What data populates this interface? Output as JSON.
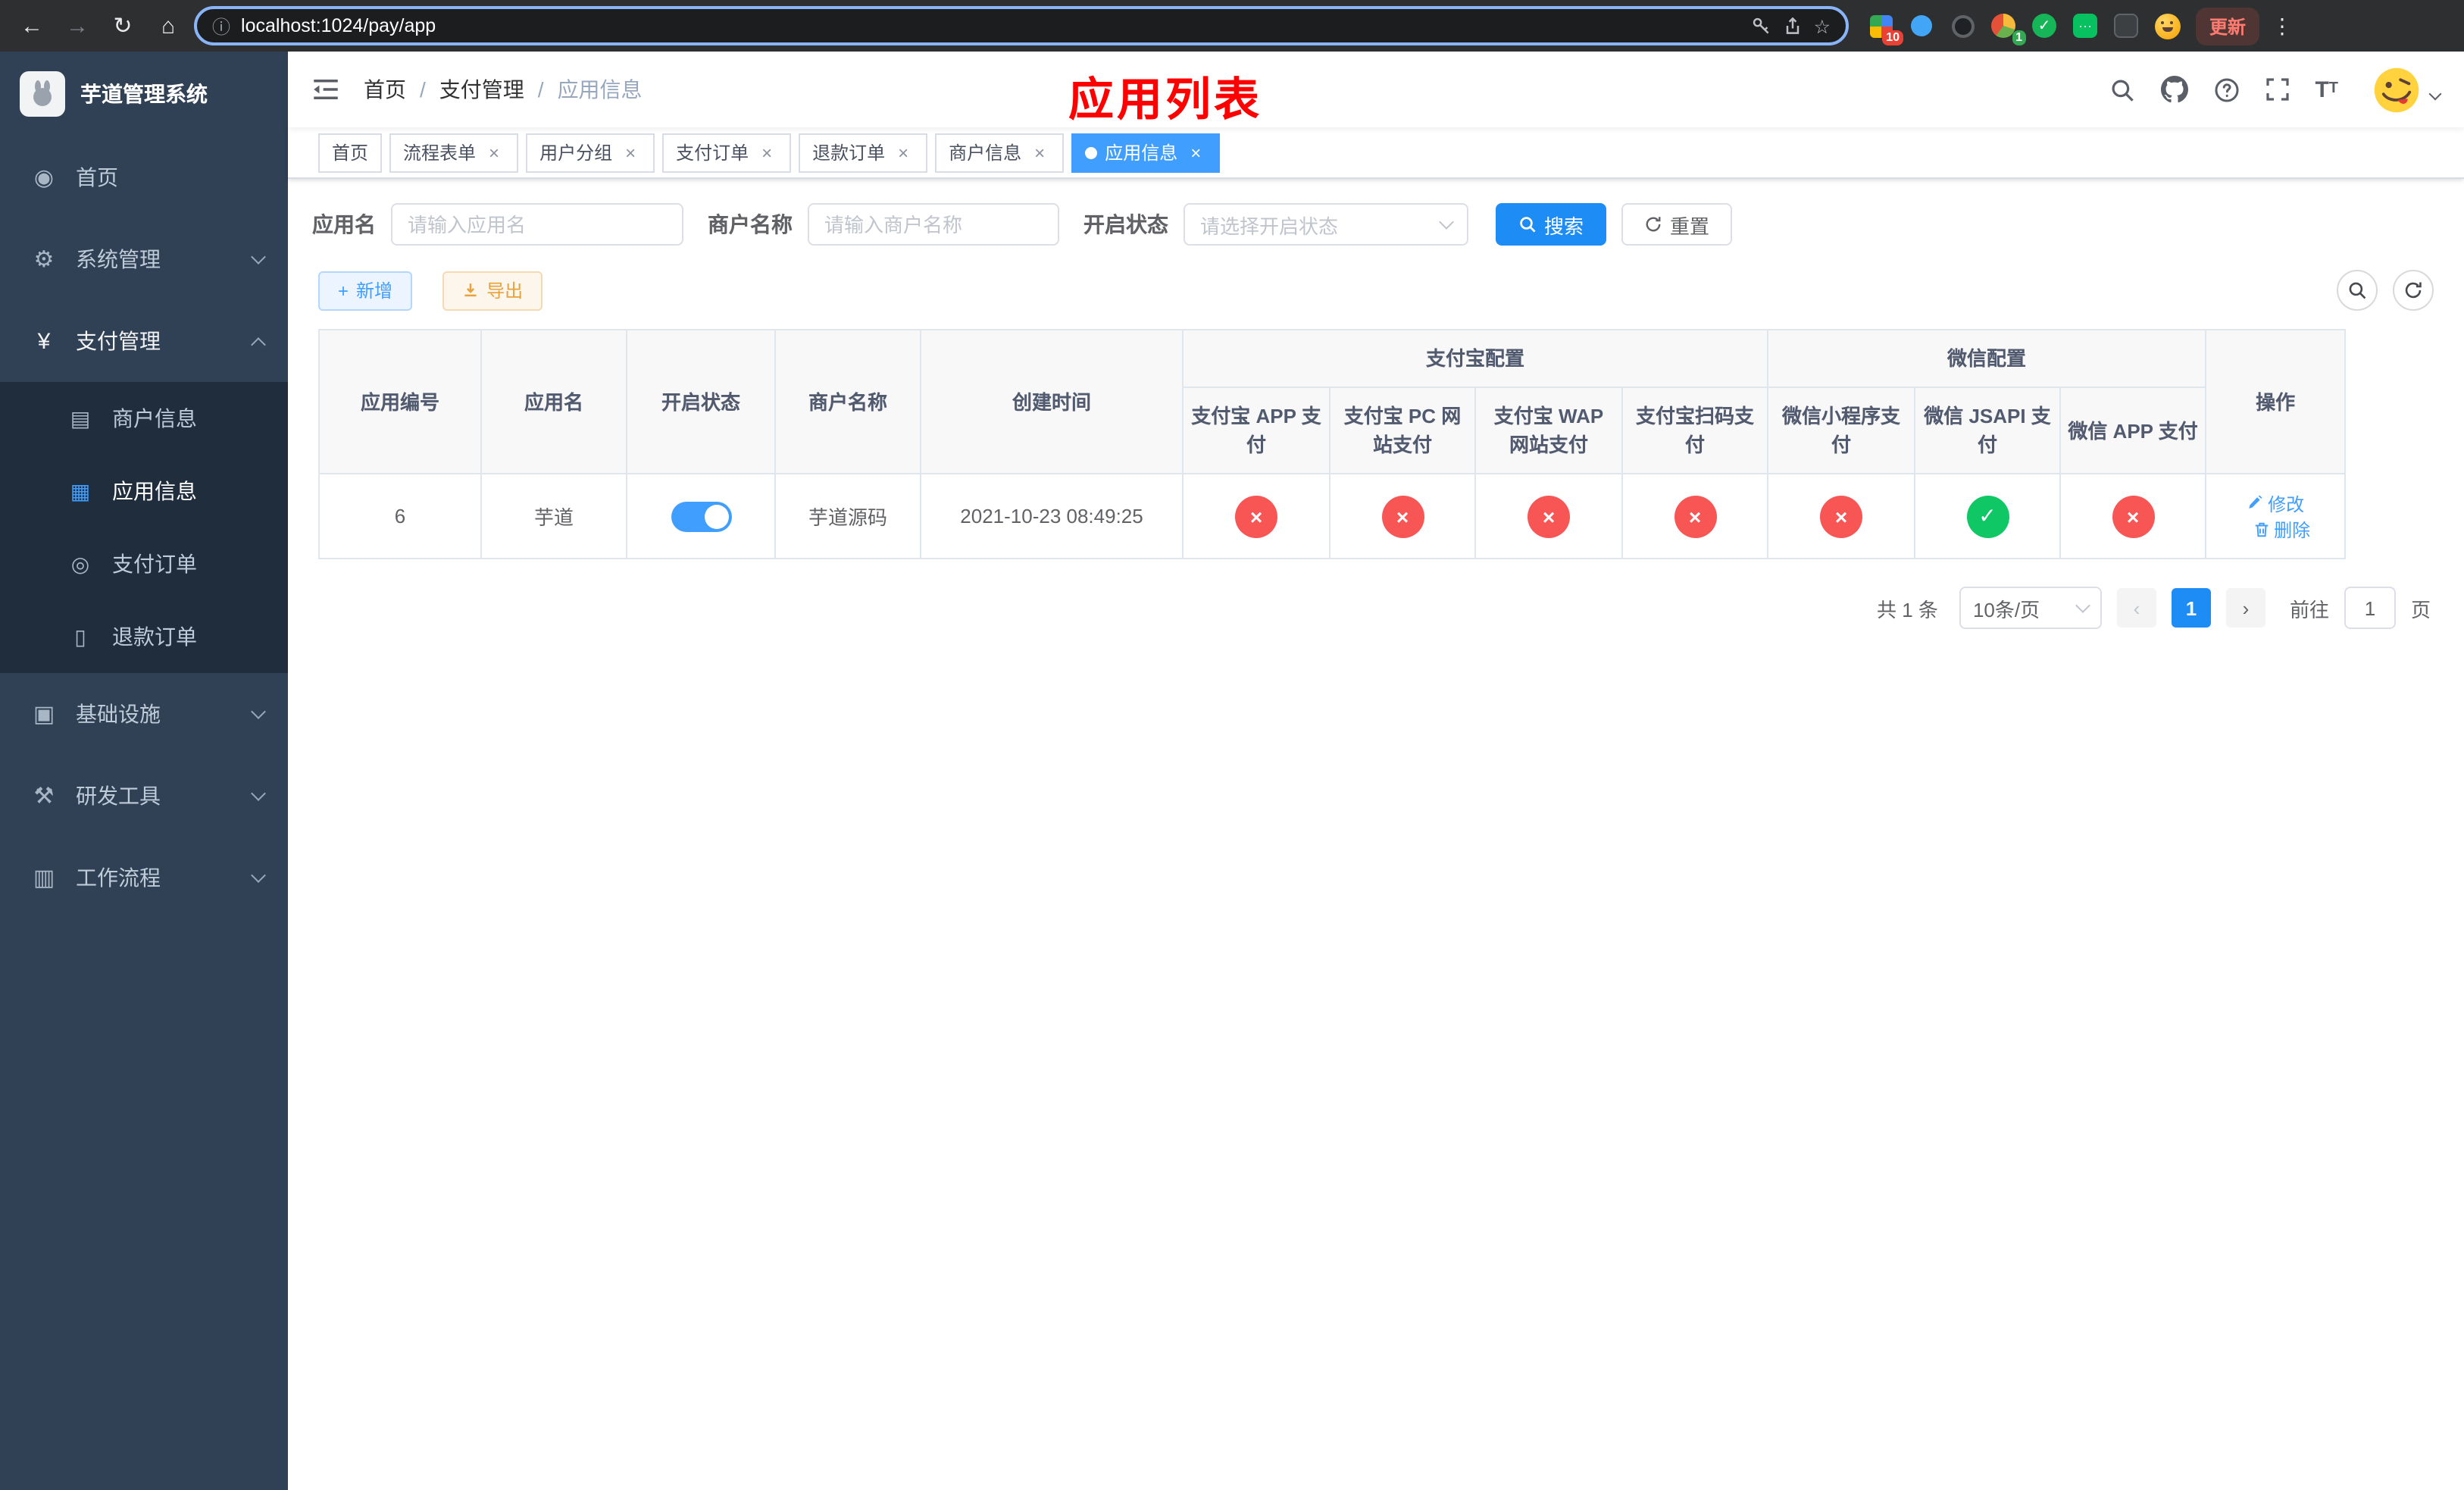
{
  "colors": {
    "accent": "#409eff",
    "primary_button": "#1d8cf5",
    "danger": "#f85555",
    "success": "#0fc764",
    "warning": "#e6a23c",
    "sidebar_bg": "#304156",
    "submenu_bg": "#1f2d3d",
    "annotation_red": "#ff0000",
    "tag_active": "#409eff"
  },
  "glyphs": {
    "close": "×",
    "check": "✓",
    "cross": "×",
    "plus": "+",
    "back": "←",
    "forward": "→",
    "reload": "↻",
    "home": "⌂",
    "info": "ⓘ",
    "star": "☆",
    "kebab": "⋮",
    "question": "?",
    "chat_dot": "···"
  },
  "browser": {
    "url": "localhost:1024/pay/app",
    "update_label": "更新",
    "ext_badge_red": "10",
    "ext_badge_green": "1"
  },
  "sidebar": {
    "title": "芋道管理系统",
    "menu": [
      {
        "label": "首页"
      },
      {
        "label": "系统管理"
      },
      {
        "label": "支付管理"
      },
      {
        "label": "基础设施"
      },
      {
        "label": "研发工具"
      },
      {
        "label": "工作流程"
      }
    ],
    "submenu_pay": [
      {
        "label": "商户信息"
      },
      {
        "label": "应用信息"
      },
      {
        "label": "支付订单"
      },
      {
        "label": "退款订单"
      }
    ]
  },
  "breadcrumb": {
    "items": [
      "首页",
      "支付管理",
      "应用信息"
    ]
  },
  "annotation": "应用列表",
  "tabs": [
    {
      "label": "首页"
    },
    {
      "label": "流程表单"
    },
    {
      "label": "用户分组"
    },
    {
      "label": "支付订单"
    },
    {
      "label": "退款订单"
    },
    {
      "label": "商户信息"
    },
    {
      "label": "应用信息"
    }
  ],
  "filters": {
    "app_name_label": "应用名",
    "app_name_placeholder": "请输入应用名",
    "merchant_label": "商户名称",
    "merchant_placeholder": "请输入商户名称",
    "status_label": "开启状态",
    "status_placeholder": "请选择开启状态",
    "search_label": "搜索",
    "reset_label": "重置"
  },
  "toolbar": {
    "add_label": "新增",
    "export_label": "导出"
  },
  "table": {
    "col_app_id": "应用编号",
    "col_app_name": "应用名",
    "col_status": "开启状态",
    "col_merchant": "商户名称",
    "col_created": "创建时间",
    "group_alipay": "支付宝配置",
    "group_wechat": "微信配置",
    "col_alipay_app": "支付宝 APP 支付",
    "col_alipay_pc": "支付宝 PC 网站支付",
    "col_alipay_wap": "支付宝 WAP 网站支付",
    "col_alipay_qr": "支付宝扫码支付",
    "col_wx_mini": "微信小程序支付",
    "col_wx_jsapi": "微信 JSAPI 支付",
    "col_wx_app": "微信 APP 支付",
    "col_op": "操作",
    "rows": [
      {
        "app_id": "6",
        "app_name": "芋道",
        "status_on": true,
        "merchant": "芋道源码",
        "created": "2021-10-23 08:49:25",
        "configs": [
          false,
          false,
          false,
          false,
          false,
          true,
          false
        ],
        "edit_label": "修改",
        "delete_label": "删除"
      }
    ]
  },
  "pagination": {
    "total": "共 1 条",
    "page_size": "10条/页",
    "page": "1",
    "goto_label": "前往",
    "goto_value": "1",
    "unit_label": "页"
  }
}
